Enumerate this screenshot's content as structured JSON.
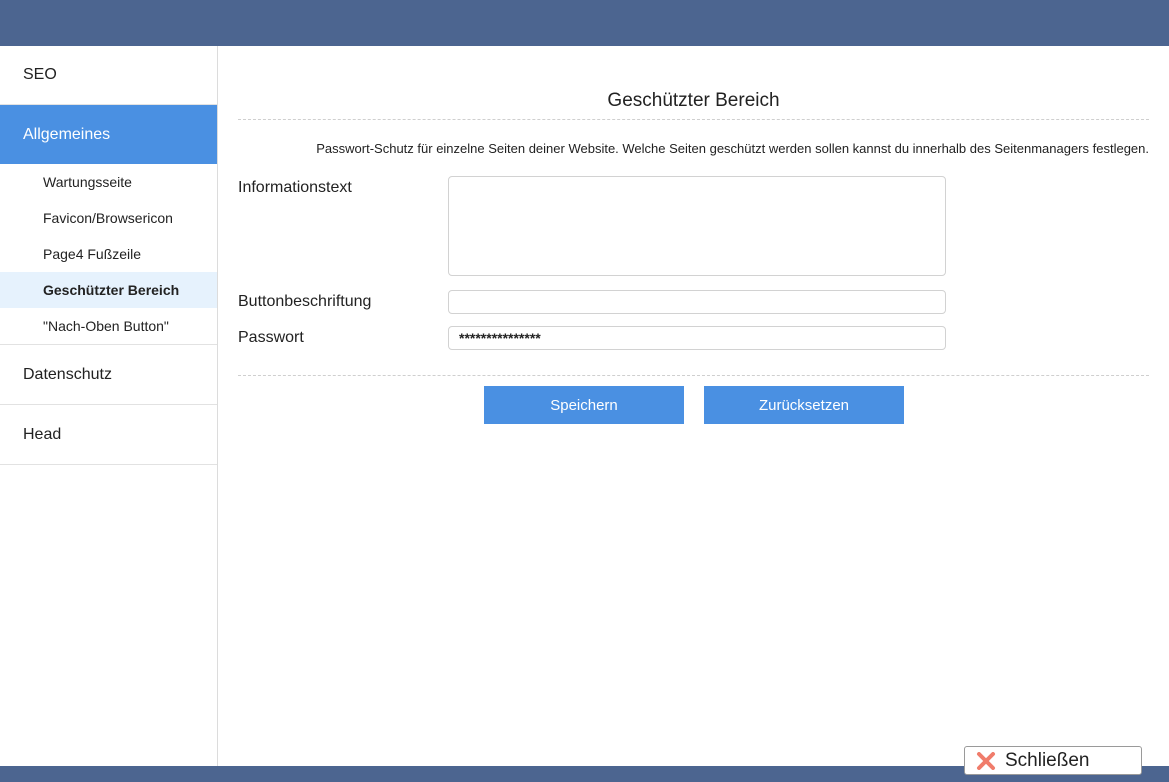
{
  "sidebar": {
    "items": [
      {
        "label": "SEO"
      },
      {
        "label": "Allgemeines"
      },
      {
        "label": "Datenschutz"
      },
      {
        "label": "Head"
      }
    ],
    "subitems": [
      {
        "label": "Wartungsseite"
      },
      {
        "label": "Favicon/Browsericon"
      },
      {
        "label": "Page4 Fußzeile"
      },
      {
        "label": "Geschützter Bereich"
      },
      {
        "label": "\"Nach-Oben Button\""
      }
    ]
  },
  "main": {
    "title": "Geschützter Bereich",
    "description": "Passwort-Schutz für einzelne Seiten deiner Website. Welche Seiten geschützt werden sollen kannst du innerhalb des Seitenmanagers festlegen.",
    "fields": {
      "info_label": "Informationstext",
      "info_value": "",
      "button_label": "Buttonbeschriftung",
      "button_value": "",
      "password_label": "Passwort",
      "password_value": "***************"
    },
    "buttons": {
      "save": "Speichern",
      "reset": "Zurücksetzen"
    }
  },
  "footer": {
    "close_label": "Schließen"
  },
  "colors": {
    "topbar": "#4c6590",
    "accent": "#4a90e2",
    "selected_sub": "#e6f2fd",
    "close_icon": "#f07c6b"
  },
  "icons": {
    "close": "close-icon"
  }
}
